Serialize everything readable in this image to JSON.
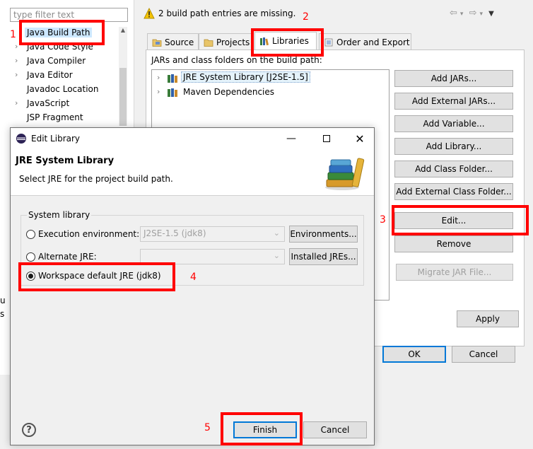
{
  "props": {
    "filter_placeholder": "type filter text",
    "tree_items": [
      {
        "label": "Java Build Path",
        "expandable": false,
        "selected": true
      },
      {
        "label": "Java Code Style",
        "expandable": true
      },
      {
        "label": "Java Compiler",
        "expandable": true
      },
      {
        "label": "Java Editor",
        "expandable": true
      },
      {
        "label": "Javadoc Location",
        "expandable": false
      },
      {
        "label": "JavaScript",
        "expandable": true
      },
      {
        "label": "JSP Fragment",
        "expandable": false
      }
    ],
    "left_fragments": [
      "u",
      "s"
    ],
    "warning": "2 build path entries are missing.",
    "tabs": [
      {
        "label": "Source",
        "icon": "source-folder-icon"
      },
      {
        "label": "Projects",
        "icon": "projects-icon"
      },
      {
        "label": "Libraries",
        "icon": "libraries-icon",
        "active": true
      },
      {
        "label": "Order and Export",
        "icon": "order-export-icon"
      }
    ],
    "panel_label": "JARs and class folders on the build path:",
    "libraries": [
      {
        "label": "JRE System Library [J2SE-1.5]",
        "selected": true
      },
      {
        "label": "Maven Dependencies"
      }
    ],
    "buttons": {
      "add_jars": "Add JARs...",
      "add_external_jars": "Add External JARs...",
      "add_variable": "Add Variable...",
      "add_library": "Add Library...",
      "add_class_folder": "Add Class Folder...",
      "add_external_class_folder": "Add External Class Folder...",
      "edit": "Edit...",
      "remove": "Remove",
      "migrate_jar": "Migrate JAR File...",
      "apply": "Apply",
      "ok": "OK",
      "cancel": "Cancel"
    }
  },
  "dialog": {
    "title": "Edit Library",
    "heading": "JRE System Library",
    "description": "Select JRE for the project build path.",
    "group_label": "System library",
    "options": {
      "execution_env": "Execution environment:",
      "execution_env_value": "J2SE-1.5 (jdk8)",
      "alternate_jre": "Alternate JRE:",
      "alternate_jre_value": "",
      "workspace_default": "Workspace default JRE (jdk8)"
    },
    "buttons": {
      "environments": "Environments...",
      "installed_jres": "Installed JREs...",
      "finish": "Finish",
      "cancel": "Cancel"
    },
    "help": "?"
  },
  "annotations": {
    "n1": "1",
    "n2": "2",
    "n3": "3",
    "n4": "4",
    "n5": "5"
  },
  "colors": {
    "annotation": "#ff0000",
    "selection": "#cde8ff",
    "default_button_border": "#0078d7"
  }
}
